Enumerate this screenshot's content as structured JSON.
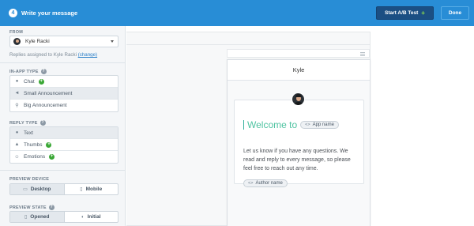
{
  "header": {
    "step": "4",
    "title": "Write your message",
    "ab_test_label": "Start A/B Test",
    "ab_plus": "+",
    "done_label": "Done"
  },
  "sidebar": {
    "from": {
      "label": "FROM",
      "selected": "Kyle Racki",
      "replies_text": "Replies assigned to Kyle Racki",
      "change_label": "(change)"
    },
    "in_app_type": {
      "label": "IN-APP TYPE",
      "options": [
        {
          "label": "Chat",
          "icon": "chat-bubble-icon",
          "has_plus": true
        },
        {
          "label": "Small Announcement",
          "icon": "megaphone-icon",
          "selected": true
        },
        {
          "label": "Big Announcement",
          "icon": "pin-icon"
        }
      ]
    },
    "reply_type": {
      "label": "REPLY TYPE",
      "options": [
        {
          "label": "Text",
          "icon": "chat-bubble-icon",
          "selected": true
        },
        {
          "label": "Thumbs",
          "icon": "thumbs-up-icon",
          "has_plus": true
        },
        {
          "label": "Emotions",
          "icon": "smiley-icon",
          "has_plus": true
        }
      ]
    },
    "preview_device": {
      "label": "PREVIEW DEVICE",
      "options": [
        "Desktop",
        "Mobile"
      ],
      "active": "Desktop"
    },
    "preview_state": {
      "label": "PREVIEW STATE",
      "options": [
        "Opened",
        "Initial"
      ],
      "active": "Opened"
    }
  },
  "preview": {
    "messenger_title": "Kyle",
    "welcome_text": "Welcome to",
    "app_name_pill": "App name",
    "body": "Let us know if you have any questions. We read and reply to every message, so please feel free to reach out any time.",
    "author_pill": "Author name",
    "pill_icon": "<>"
  },
  "colors": {
    "topbar": "#288dd6",
    "ab_button": "#1b4f83",
    "accent_green": "#3aa735",
    "welcome_teal": "#4fc3a1"
  }
}
